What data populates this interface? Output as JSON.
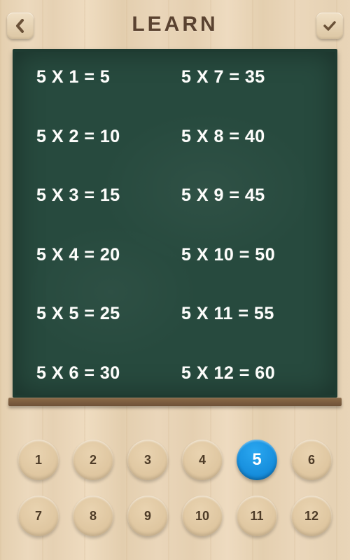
{
  "header": {
    "title": "LEARN"
  },
  "icons": {
    "back": "chevron-left",
    "confirm": "check"
  },
  "table": {
    "multiplier": 5,
    "left": [
      {
        "a": 5,
        "b": 1,
        "r": 5
      },
      {
        "a": 5,
        "b": 2,
        "r": 10
      },
      {
        "a": 5,
        "b": 3,
        "r": 15
      },
      {
        "a": 5,
        "b": 4,
        "r": 20
      },
      {
        "a": 5,
        "b": 5,
        "r": 25
      },
      {
        "a": 5,
        "b": 6,
        "r": 30
      }
    ],
    "right": [
      {
        "a": 5,
        "b": 7,
        "r": 35
      },
      {
        "a": 5,
        "b": 8,
        "r": 40
      },
      {
        "a": 5,
        "b": 9,
        "r": 45
      },
      {
        "a": 5,
        "b": 10,
        "r": 50
      },
      {
        "a": 5,
        "b": 11,
        "r": 55
      },
      {
        "a": 5,
        "b": 12,
        "r": 60
      }
    ]
  },
  "selector": {
    "selected": 5,
    "row1": [
      1,
      2,
      3,
      4,
      5,
      6
    ],
    "row2": [
      7,
      8,
      9,
      10,
      11,
      12
    ]
  },
  "colors": {
    "accent": "#0b7fd1",
    "board": "#274a3e",
    "title": "#5a4230"
  }
}
